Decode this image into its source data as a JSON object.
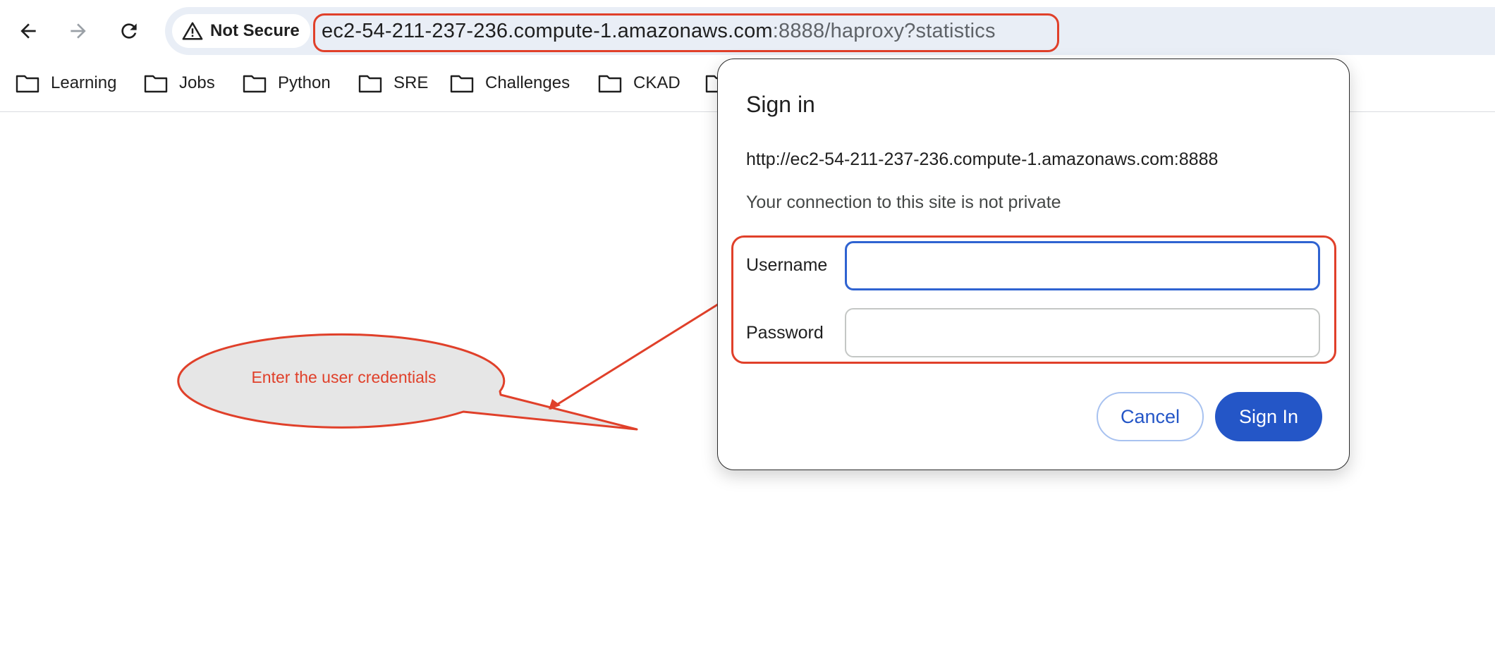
{
  "browser": {
    "toolbar": {
      "back_icon": "arrow-back-icon",
      "forward_icon": "arrow-forward-icon",
      "reload_icon": "reload-icon"
    },
    "omnibox": {
      "security_label": "Not Secure",
      "security_icon": "warning-triangle-icon",
      "url_host": "ec2-54-211-237-236.compute-1.amazonaws.com",
      "url_path": ":8888/haproxy?statistics"
    },
    "bookmarks": [
      {
        "label": "Learning",
        "icon": "folder-icon"
      },
      {
        "label": "Jobs",
        "icon": "folder-icon"
      },
      {
        "label": "Python",
        "icon": "folder-icon"
      },
      {
        "label": "SRE",
        "icon": "folder-icon"
      },
      {
        "label": "Challenges",
        "icon": "folder-icon"
      },
      {
        "label": "CKAD",
        "icon": "folder-icon"
      },
      {
        "label": "",
        "icon": "folder-icon"
      }
    ]
  },
  "dialog": {
    "title": "Sign in",
    "origin": "http://ec2-54-211-237-236.compute-1.amazonaws.com:8888",
    "warning": "Your connection to this site is not private",
    "username_label": "Username",
    "username_value": "",
    "password_label": "Password",
    "password_value": "",
    "cancel_label": "Cancel",
    "signin_label": "Sign In"
  },
  "annotation": {
    "text": "Enter the user credentials"
  },
  "colors": {
    "annotation_red": "#e0402a",
    "accent_blue": "#2456c7",
    "focus_blue": "#2f63d1",
    "omnibox_bg": "#e9eef6",
    "callout_fill": "#e6e6e6"
  }
}
